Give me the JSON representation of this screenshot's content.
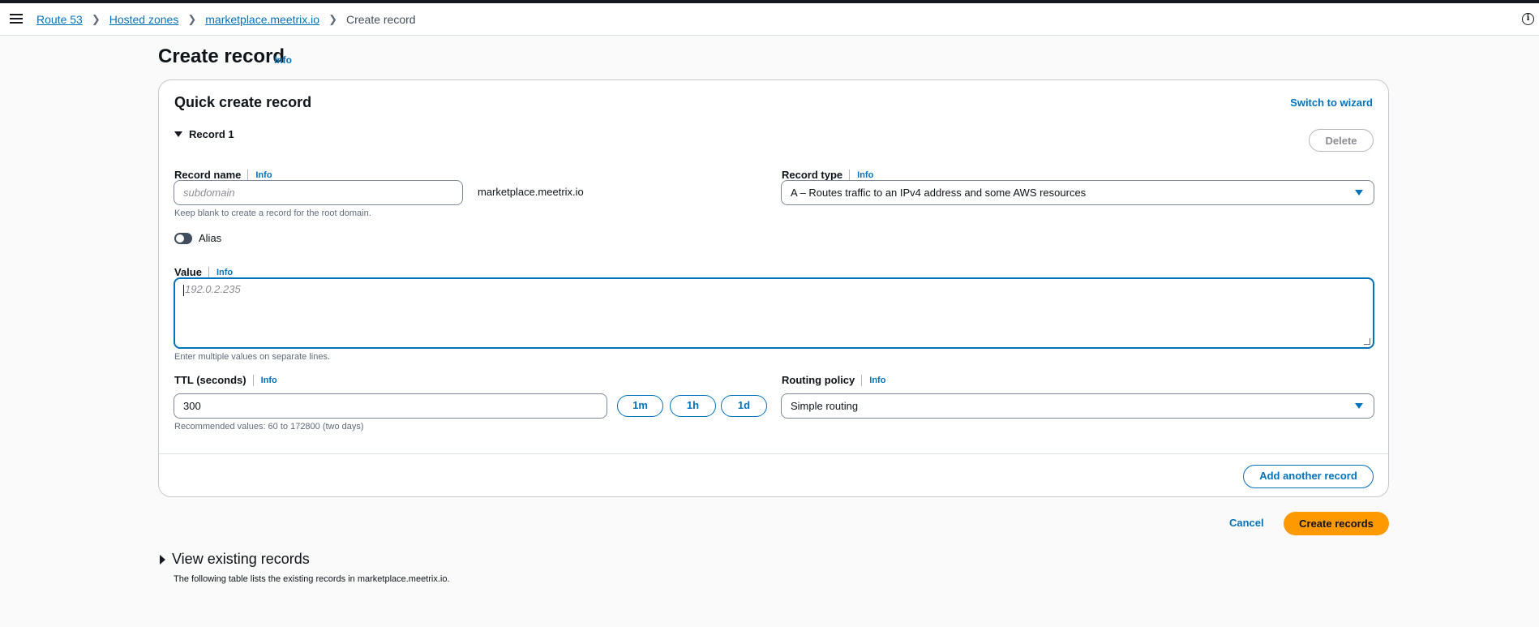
{
  "breadcrumb": {
    "items": [
      "Route 53",
      "Hosted zones",
      "marketplace.meetrix.io"
    ],
    "current": "Create record"
  },
  "page": {
    "title": "Create record",
    "info": "Info"
  },
  "card": {
    "title": "Quick create record",
    "switch_wizard": "Switch to wizard",
    "record_toggle": "Record 1",
    "delete_label": "Delete"
  },
  "record_name": {
    "label": "Record name",
    "info": "Info",
    "placeholder": "subdomain",
    "suffix": "marketplace.meetrix.io",
    "hint": "Keep blank to create a record for the root domain."
  },
  "record_type": {
    "label": "Record type",
    "info": "Info",
    "selected": "A – Routes traffic to an IPv4 address and some AWS resources"
  },
  "alias": {
    "label": "Alias",
    "enabled": false
  },
  "value": {
    "label": "Value",
    "info": "Info",
    "placeholder": "192.0.2.235",
    "hint": "Enter multiple values on separate lines."
  },
  "ttl": {
    "label": "TTL (seconds)",
    "info": "Info",
    "value": "300",
    "presets": [
      "1m",
      "1h",
      "1d"
    ],
    "hint": "Recommended values: 60 to 172800 (two days)"
  },
  "routing_policy": {
    "label": "Routing policy",
    "info": "Info",
    "selected": "Simple routing"
  },
  "actions": {
    "add_another": "Add another record",
    "cancel": "Cancel",
    "create": "Create records"
  },
  "existing": {
    "title": "View existing records",
    "hint": "The following table lists the existing records in marketplace.meetrix.io."
  },
  "colors": {
    "link": "#0073bb",
    "primary_button": "#ff9900",
    "focus_border": "#0073bb"
  },
  "icons": [
    "menu-icon",
    "chevron-right-icon",
    "info-circle-icon",
    "caret-down-icon",
    "caret-right-icon"
  ]
}
